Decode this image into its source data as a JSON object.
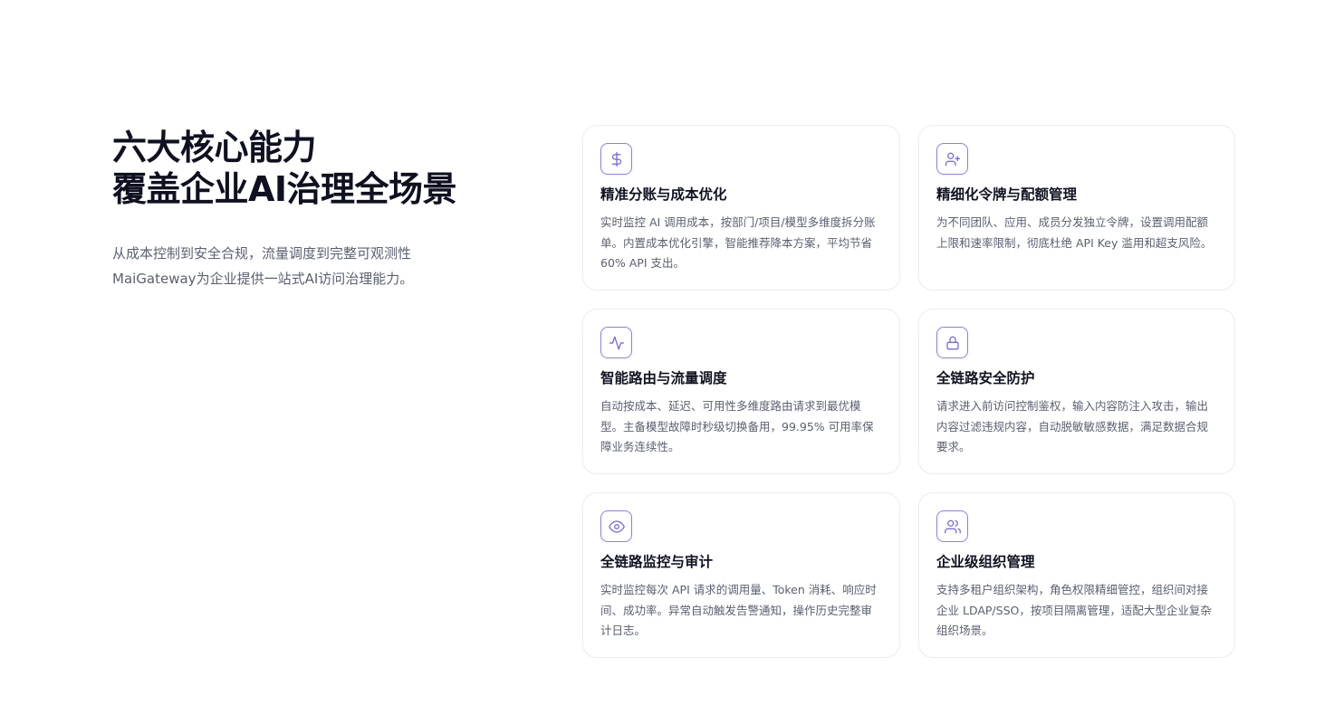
{
  "intro": {
    "title_line1": "六大核心能力",
    "title_line2": "覆盖企业AI治理全场景",
    "subtitle_line1": "从成本控制到安全合规，流量调度到完整可观测性",
    "subtitle_line2": "MaiGateway为企业提供一站式AI访问治理能力。"
  },
  "accent_color": "#6e5ce6",
  "features": [
    {
      "icon": "dollar-icon",
      "title": "精准分账与成本优化",
      "desc": "实时监控 AI 调用成本，按部门/项目/模型多维度拆分账单。内置成本优化引擎，智能推荐降本方案，平均节省 60% API 支出。"
    },
    {
      "icon": "user-plus-icon",
      "title": "精细化令牌与配额管理",
      "desc": "为不同团队、应用、成员分发独立令牌，设置调用配额上限和速率限制，彻底杜绝 API Key 滥用和超支风险。"
    },
    {
      "icon": "activity-icon",
      "title": "智能路由与流量调度",
      "desc": "自动按成本、延迟、可用性多维度路由请求到最优模型。主备模型故障时秒级切换备用，99.95% 可用率保障业务连续性。"
    },
    {
      "icon": "lock-icon",
      "title": "全链路安全防护",
      "desc": "请求进入前访问控制鉴权，输入内容防注入攻击，输出内容过滤违规内容，自动脱敏敏感数据，满足数据合规要求。"
    },
    {
      "icon": "eye-icon",
      "title": "全链路监控与审计",
      "desc": "实时监控每次 API 请求的调用量、Token 消耗、响应时间、成功率。异常自动触发告警通知，操作历史完整审计日志。"
    },
    {
      "icon": "users-icon",
      "title": "企业级组织管理",
      "desc": "支持多租户组织架构，角色权限精细管控，组织间对接企业 LDAP/SSO，按项目隔离管理，适配大型企业复杂组织场景。"
    }
  ]
}
